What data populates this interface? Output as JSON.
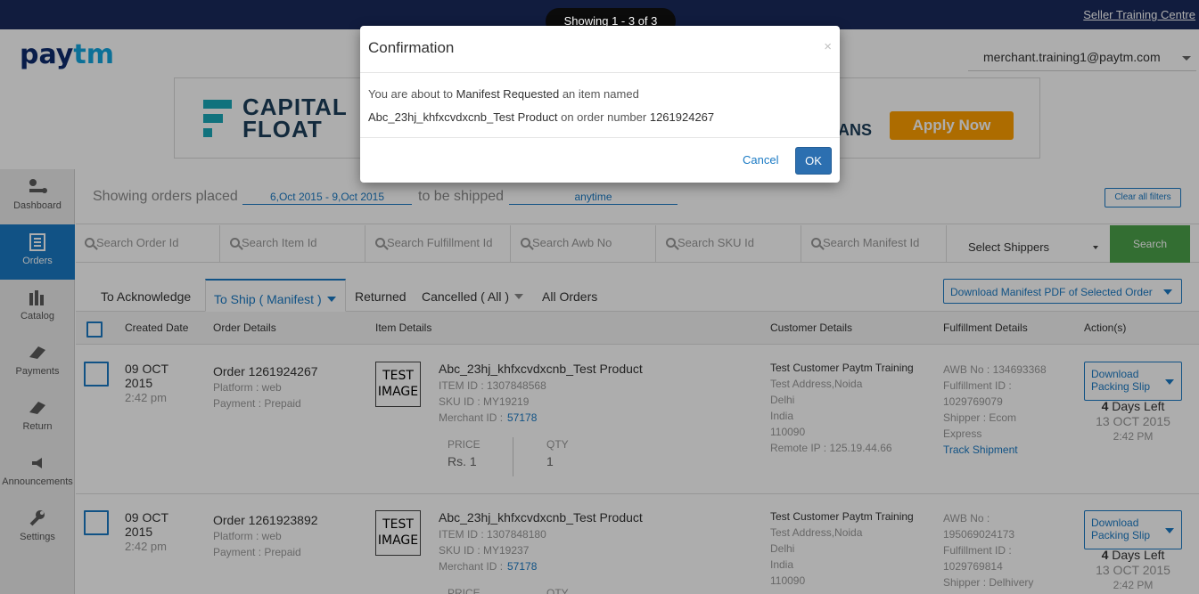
{
  "topbar": {
    "training_link": "Seller Training Centre",
    "showing": "Showing 1 - 3 of 3"
  },
  "header": {
    "logo_a": "pay",
    "logo_b": "tm",
    "user_email": "merchant.training1@paytm.com"
  },
  "banner": {
    "brand_line1": "CAPITAL",
    "brand_line2": "FLOAT",
    "tail_text": "ANS",
    "apply_label": "Apply Now"
  },
  "sidebar": {
    "items": [
      {
        "label": "Dashboard",
        "icon": "dashboard-icon"
      },
      {
        "label": "Orders",
        "icon": "orders-icon"
      },
      {
        "label": "Catalog",
        "icon": "catalog-icon"
      },
      {
        "label": "Payments",
        "icon": "payments-icon"
      },
      {
        "label": "Return",
        "icon": "return-icon"
      },
      {
        "label": "Announcements",
        "icon": "announcements-icon"
      },
      {
        "label": "Settings",
        "icon": "wrench-icon"
      }
    ]
  },
  "filters": {
    "placed_label": "Showing orders placed",
    "placed_range": "6,Oct 2015 - 9,Oct 2015",
    "ship_label": "to be shipped",
    "ship_range": "anytime",
    "clear_label": "Clear all filters"
  },
  "search": {
    "order_id": "Search Order Id",
    "item_id": "Search Item Id",
    "fulfillment_id": "Search Fulfillment Id",
    "awb": "Search Awb No",
    "sku": "Search SKU Id",
    "manifest": "Search Manifest Id",
    "shippers": "Select Shippers",
    "button": "Search"
  },
  "tabs": {
    "acknowledge": "To Acknowledge",
    "to_ship": "To Ship ( Manifest )",
    "returned": "Returned",
    "cancelled": "Cancelled ( All )",
    "all": "All Orders",
    "download_manifest": "Download Manifest PDF of Selected Order"
  },
  "table": {
    "headers": {
      "created": "Created Date",
      "order": "Order Details",
      "item": "Item Details",
      "customer": "Customer Details",
      "fulfillment": "Fulfillment Details",
      "actions": "Action(s)"
    },
    "rows": [
      {
        "date": "09 OCT",
        "year": "2015",
        "time": "2:42 pm",
        "order": "Order 1261924267",
        "platform": "Platform : web",
        "payment": "Payment : Prepaid",
        "image_text_1": "TEST",
        "image_text_2": "IMAGE",
        "product": "Abc_23hj_khfxcvdxcnb_Test Product",
        "item_id": "ITEM ID : 1307848568",
        "sku": "SKU ID : MY19219",
        "merchant_label": "Merchant ID :",
        "merchant_id": "57178",
        "price_label": "PRICE",
        "price": "Rs. 1",
        "qty_label": "QTY",
        "qty": "1",
        "cust_name": "Test Customer Paytm Training",
        "cust_addr": "Test Address,Noida",
        "cust_city": "Delhi",
        "cust_country": "India",
        "cust_pin": "110090",
        "cust_ip": "Remote IP : 125.19.44.66",
        "awb": "AWB No : 134693368",
        "fid_label": "Fulfillment ID :",
        "fid": "1029769079",
        "shipper": "Shipper : Ecom",
        "shipper2": "Express",
        "track": "Track Shipment",
        "action": "Download Packing Slip",
        "days_num": "4",
        "days_text": "Days Left",
        "due_date": "13 OCT 2015",
        "due_time": "2:42 PM"
      },
      {
        "date": "09 OCT",
        "year": "2015",
        "time": "2:42 pm",
        "order": "Order 1261923892",
        "platform": "Platform : web",
        "payment": "Payment : Prepaid",
        "image_text_1": "TEST",
        "image_text_2": "IMAGE",
        "product": "Abc_23hj_khfxcvdxcnb_Test Product",
        "item_id": "ITEM ID : 1307848180",
        "sku": "SKU ID : MY19237",
        "merchant_label": "Merchant ID :",
        "merchant_id": "57178",
        "price_label": "PRICE",
        "qty_label": "QTY",
        "cust_name": "Test Customer Paytm Training",
        "cust_addr": "Test Address,Noida",
        "cust_city": "Delhi",
        "cust_country": "India",
        "cust_pin": "110090",
        "awb_label": "AWB No :",
        "awb": "195069024173",
        "fid_label": "Fulfillment ID :",
        "fid": "1029769814",
        "shipper": "Shipper : Delhivery",
        "action": "Download Packing Slip",
        "days_num": "4",
        "days_text": "Days Left",
        "due_date": "13 OCT 2015",
        "due_time": "2:42 PM"
      }
    ]
  },
  "modal": {
    "title": "Confirmation",
    "close": "×",
    "text_a": "You are about to",
    "action": "Manifest Requested",
    "text_b": "an item named",
    "product": "Abc_23hj_khfxcvdxcnb_Test Product",
    "text_c": "on order number",
    "order_number": "1261924267",
    "cancel": "Cancel",
    "ok": "OK"
  }
}
